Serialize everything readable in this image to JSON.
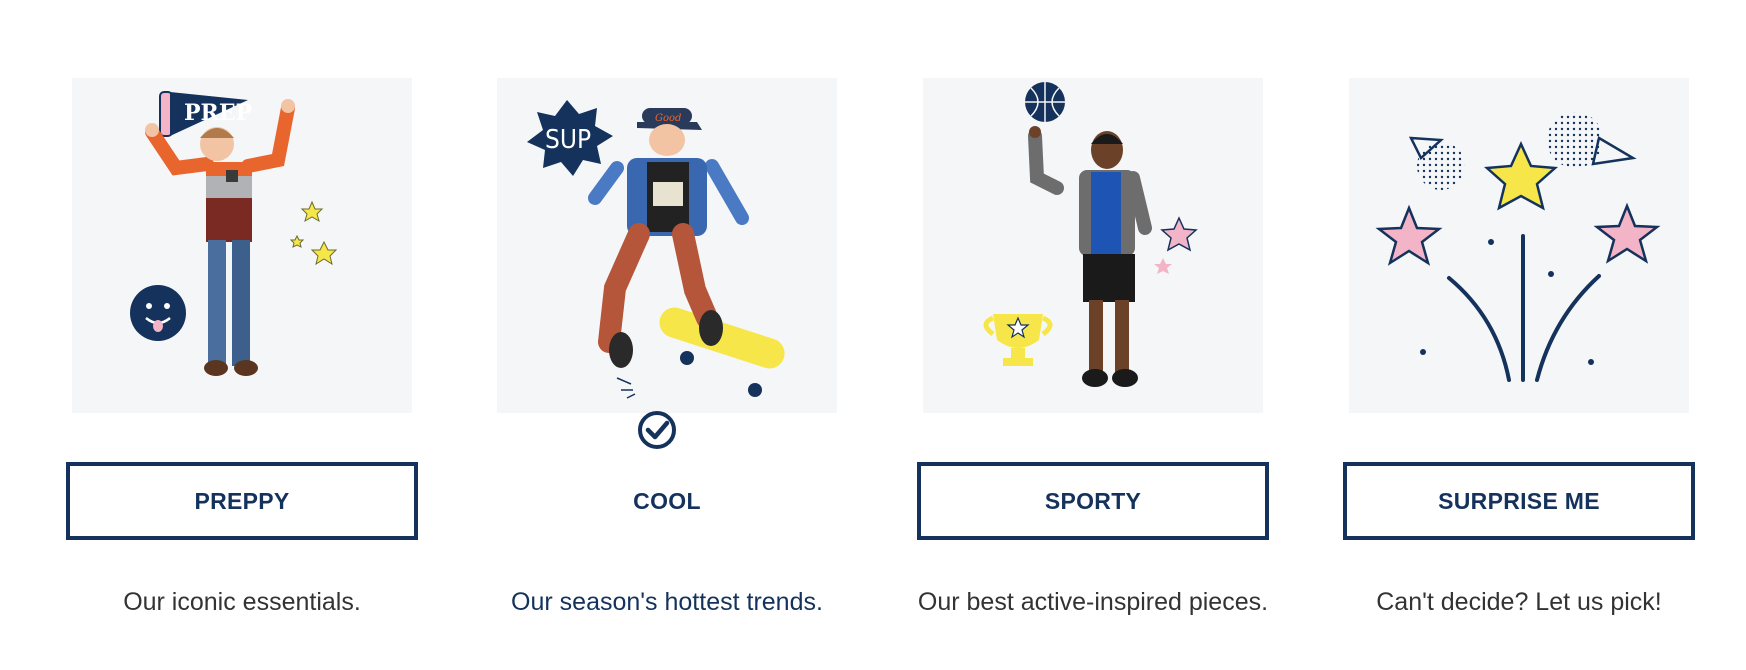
{
  "colors": {
    "navy": "#14325c",
    "card_bg": "#f5f6f8",
    "yellow": "#f6e64a",
    "pink": "#f4b4c8",
    "text": "#333333"
  },
  "options": [
    {
      "label": "PREPPY",
      "description": "Our iconic essentials.",
      "selected": false,
      "image": "boy-preppy-outfit-with-prep-pennant"
    },
    {
      "label": "COOL",
      "description": "Our season's hottest trends.",
      "selected": true,
      "image": "boy-jumping-on-skateboard-with-sup-sticker"
    },
    {
      "label": "SPORTY",
      "description": "Our best active-inspired pieces.",
      "selected": false,
      "image": "boy-spinning-basketball-with-trophy"
    },
    {
      "label": "SURPRISE ME",
      "description": "Can't decide? Let us pick!",
      "selected": false,
      "image": "stars-and-fireworks-illustration"
    }
  ],
  "stickers": {
    "pennant_text": "PREP",
    "sup_text": "SUP",
    "cap_text": "Good"
  },
  "selected_icon": "check-circle-icon"
}
